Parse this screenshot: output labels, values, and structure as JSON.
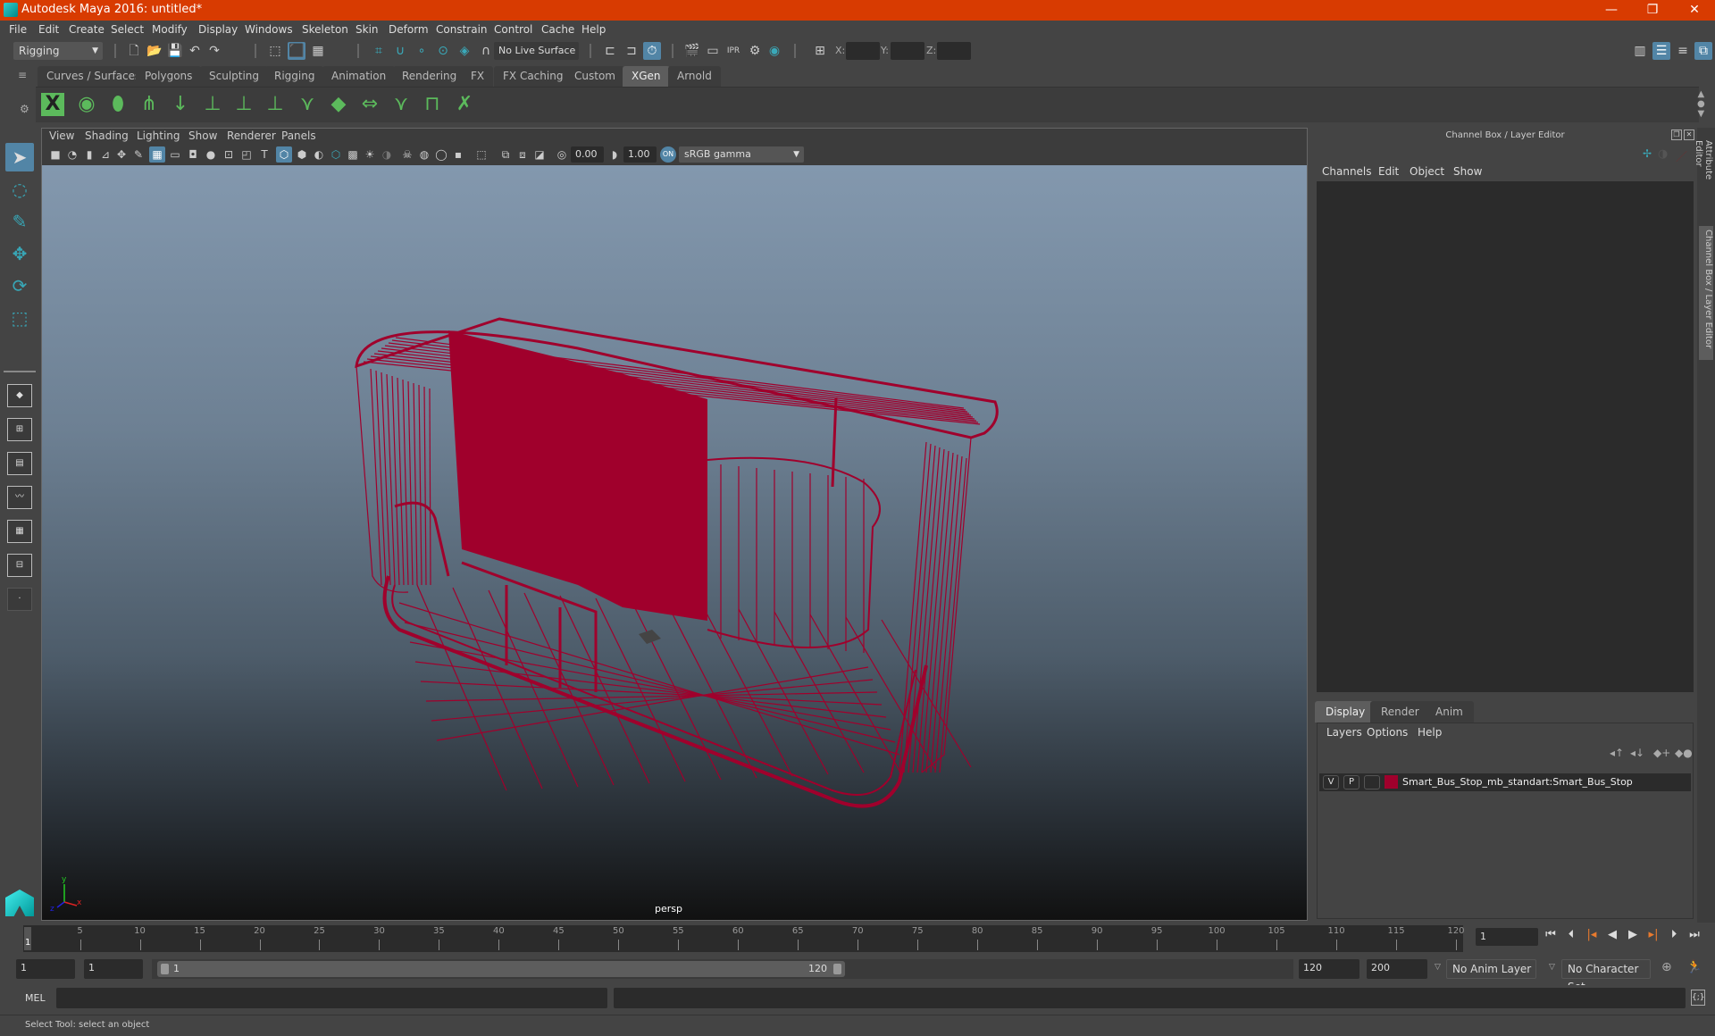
{
  "app": {
    "title": "Autodesk Maya 2016: untitled*",
    "window_controls": {
      "minimize": "—",
      "restore": "❐",
      "close": "✕"
    }
  },
  "menubar": [
    "File",
    "Edit",
    "Create",
    "Select",
    "Modify",
    "Display",
    "Windows",
    "Skeleton",
    "Skin",
    "Deform",
    "Constrain",
    "Control",
    "Cache",
    "Help"
  ],
  "status_line": {
    "menu_set": "Rigging",
    "live_surface": "No Live Surface",
    "xyz": {
      "x_label": "X:",
      "y_label": "Y:",
      "z_label": "Z:",
      "x": "",
      "y": "",
      "z": ""
    }
  },
  "shelf": {
    "tabs": [
      "Curves / Surfaces",
      "Polygons",
      "Sculpting",
      "Rigging",
      "Animation",
      "Rendering",
      "FX",
      "FX Caching",
      "Custom",
      "XGen",
      "Arnold"
    ],
    "active_tab": "XGen",
    "xgen_icons": [
      "xgen-window-icon",
      "preview-icon",
      "hide-preview-icon",
      "add-guides-icon",
      "place-guides-icon",
      "add-guide-icon",
      "show-guide-icon",
      "lock-guide-icon",
      "sculpt-guide-icon",
      "flatten-guide-icon",
      "comb-guide-icon",
      "select-guide-icon",
      "toggle-guide-icon",
      "delete-guide-icon"
    ]
  },
  "viewport": {
    "menu": [
      "View",
      "Shading",
      "Lighting",
      "Show",
      "Renderer",
      "Panels"
    ],
    "exposure": "0.00",
    "gamma": "1.00",
    "color_space": "sRGB gamma",
    "camera_label": "persp",
    "wire_color": "#a0002c"
  },
  "channel_box": {
    "title": "Channel Box / Layer Editor",
    "menu": [
      "Channels",
      "Edit",
      "Object",
      "Show"
    ]
  },
  "layer_editor": {
    "tabs": [
      "Display",
      "Render",
      "Anim"
    ],
    "active_tab": "Display",
    "menu": [
      "Layers",
      "Options",
      "Help"
    ],
    "layers": [
      {
        "visible": "V",
        "playback": "P",
        "name": "Smart_Bus_Stop_mb_standart:Smart_Bus_Stop",
        "color": "#a0002c"
      }
    ]
  },
  "side_tabs": [
    "Attribute Editor",
    "Channel Box / Layer Editor"
  ],
  "timeline": {
    "ticks": [
      5,
      10,
      15,
      20,
      25,
      30,
      35,
      40,
      45,
      50,
      55,
      60,
      65,
      70,
      75,
      80,
      85,
      90,
      95,
      100,
      105,
      110,
      115,
      120
    ],
    "start": 1,
    "end": 120,
    "current_frame_marker": "1",
    "current_frame": "1"
  },
  "range": {
    "start_time": "1",
    "playback_start": "1",
    "slider_start": "1",
    "slider_end": "120",
    "playback_end": "120",
    "end_time": "200",
    "anim_layer": "No Anim Layer",
    "character_set": "No Character Set"
  },
  "command_line": {
    "label": "MEL",
    "value": "",
    "result": ""
  },
  "help_line": "Select Tool: select an object"
}
